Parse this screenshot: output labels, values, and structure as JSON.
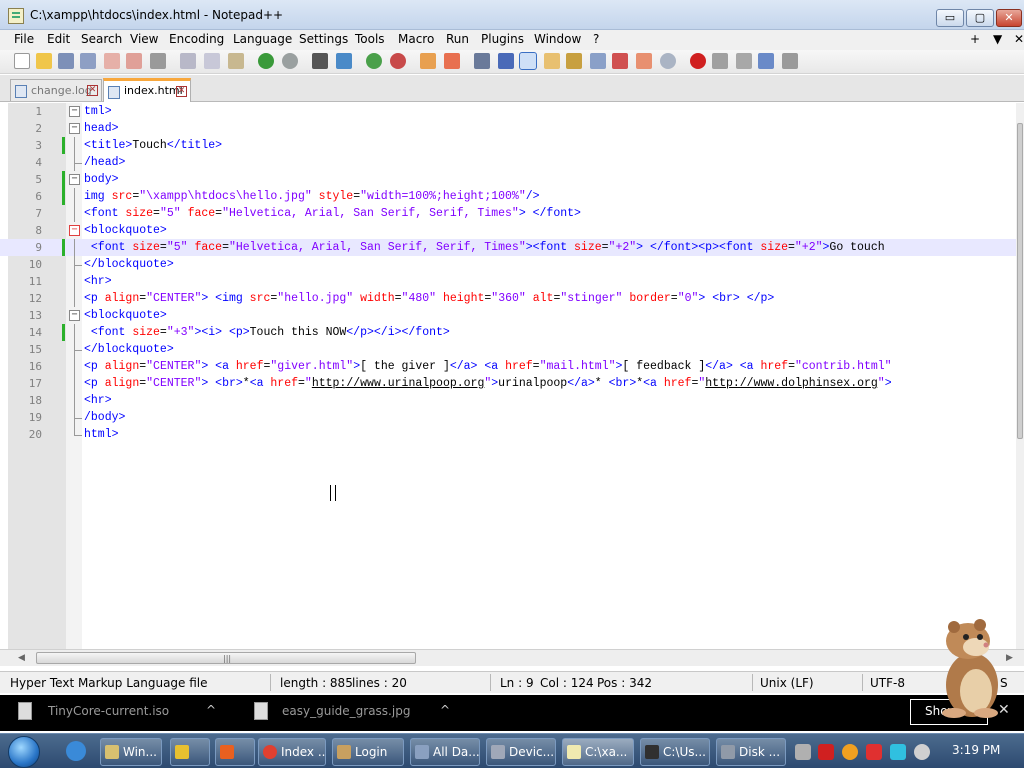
{
  "window": {
    "title": "C:\\xampp\\htdocs\\index.html - Notepad++",
    "min_glyph": "▭",
    "max_glyph": "▢",
    "close_glyph": "✕"
  },
  "menu": {
    "items": [
      "File",
      "Edit",
      "Search",
      "View",
      "Encoding",
      "Language",
      "Settings",
      "Tools",
      "Macro",
      "Run",
      "Plugins",
      "Window",
      "?"
    ],
    "right": [
      "+",
      "▼",
      "✕"
    ]
  },
  "tabs": [
    {
      "label": "change.log",
      "active": false
    },
    {
      "label": "index.html",
      "active": true
    }
  ],
  "editor": {
    "current_line": 9,
    "lines": [
      {
        "n": "1",
        "seg": [
          [
            "t",
            "tml>"
          ]
        ]
      },
      {
        "n": "2",
        "seg": [
          [
            "t",
            "head>"
          ]
        ]
      },
      {
        "n": "3",
        "seg": [
          [
            "t",
            "<title>"
          ],
          [
            "x",
            "Touch"
          ],
          [
            "t",
            "</title>"
          ]
        ]
      },
      {
        "n": "4",
        "seg": [
          [
            "t",
            "/head>"
          ]
        ]
      },
      {
        "n": "5",
        "seg": [
          [
            "t",
            "body>"
          ]
        ]
      },
      {
        "n": "6",
        "seg": [
          [
            "t",
            "img "
          ],
          [
            "a",
            "src"
          ],
          [
            "x",
            "="
          ],
          [
            "v",
            "\"\\xampp\\htdocs\\hello.jpg\""
          ],
          [
            "x",
            " "
          ],
          [
            "a",
            "style"
          ],
          [
            "x",
            "="
          ],
          [
            "v",
            "\"width=100%;height;100%\""
          ],
          [
            "t",
            "/>"
          ]
        ]
      },
      {
        "n": "7",
        "seg": [
          [
            "t",
            "<font "
          ],
          [
            "a",
            "size"
          ],
          [
            "x",
            "="
          ],
          [
            "v",
            "\"5\""
          ],
          [
            "x",
            " "
          ],
          [
            "a",
            "face"
          ],
          [
            "x",
            "="
          ],
          [
            "v",
            "\"Helvetica, Arial, San Serif, Serif, Times\""
          ],
          [
            "t",
            "> </font>"
          ]
        ]
      },
      {
        "n": "8",
        "seg": [
          [
            "t",
            "<blockquote>"
          ]
        ]
      },
      {
        "n": "9",
        "seg": [
          [
            "t",
            " <font "
          ],
          [
            "a",
            "size"
          ],
          [
            "x",
            "="
          ],
          [
            "v",
            "\"5\""
          ],
          [
            "x",
            " "
          ],
          [
            "a",
            "face"
          ],
          [
            "x",
            "="
          ],
          [
            "v",
            "\"Helvetica, Arial, San Serif, Serif, Times\""
          ],
          [
            "t",
            "><font "
          ],
          [
            "a",
            "size"
          ],
          [
            "x",
            "="
          ],
          [
            "v",
            "\"+2\""
          ],
          [
            "t",
            "> </font><p><font "
          ],
          [
            "a",
            "size"
          ],
          [
            "x",
            "="
          ],
          [
            "v",
            "\"+2\""
          ],
          [
            "t",
            ">"
          ],
          [
            "x",
            "Go touch"
          ]
        ]
      },
      {
        "n": "10",
        "seg": [
          [
            "t",
            "</blockquote>"
          ]
        ]
      },
      {
        "n": "11",
        "seg": [
          [
            "t",
            "<hr>"
          ]
        ]
      },
      {
        "n": "12",
        "seg": [
          [
            "t",
            "<p "
          ],
          [
            "a",
            "align"
          ],
          [
            "x",
            "="
          ],
          [
            "v",
            "\"CENTER\""
          ],
          [
            "t",
            "> <img "
          ],
          [
            "a",
            "src"
          ],
          [
            "x",
            "="
          ],
          [
            "v",
            "\"hello.jpg\""
          ],
          [
            "x",
            " "
          ],
          [
            "a",
            "width"
          ],
          [
            "x",
            "="
          ],
          [
            "v",
            "\"480\""
          ],
          [
            "x",
            " "
          ],
          [
            "a",
            "height"
          ],
          [
            "x",
            "="
          ],
          [
            "v",
            "\"360\""
          ],
          [
            "x",
            " "
          ],
          [
            "a",
            "alt"
          ],
          [
            "x",
            "="
          ],
          [
            "v",
            "\"stinger\""
          ],
          [
            "x",
            " "
          ],
          [
            "a",
            "border"
          ],
          [
            "x",
            "="
          ],
          [
            "v",
            "\"0\""
          ],
          [
            "t",
            "> <br> </p>"
          ]
        ]
      },
      {
        "n": "13",
        "seg": [
          [
            "t",
            "<blockquote>"
          ]
        ]
      },
      {
        "n": "14",
        "seg": [
          [
            "t",
            " <font "
          ],
          [
            "a",
            "size"
          ],
          [
            "x",
            "="
          ],
          [
            "v",
            "\"+3\""
          ],
          [
            "t",
            "><i> <p>"
          ],
          [
            "x",
            "Touch this NOW"
          ],
          [
            "t",
            "</p></i></font>"
          ]
        ]
      },
      {
        "n": "15",
        "seg": [
          [
            "t",
            "</blockquote>"
          ]
        ]
      },
      {
        "n": "16",
        "seg": [
          [
            "t",
            "<p "
          ],
          [
            "a",
            "align"
          ],
          [
            "x",
            "="
          ],
          [
            "v",
            "\"CENTER\""
          ],
          [
            "t",
            "> <a "
          ],
          [
            "a",
            "href"
          ],
          [
            "x",
            "="
          ],
          [
            "v",
            "\"giver.html\""
          ],
          [
            "t",
            ">"
          ],
          [
            "x",
            "[ the giver ]"
          ],
          [
            "t",
            "</a> <a "
          ],
          [
            "a",
            "href"
          ],
          [
            "x",
            "="
          ],
          [
            "v",
            "\"mail.html\""
          ],
          [
            "t",
            ">"
          ],
          [
            "x",
            "[ feedback ]"
          ],
          [
            "t",
            "</a> <a "
          ],
          [
            "a",
            "href"
          ],
          [
            "x",
            "="
          ],
          [
            "v",
            "\"contrib.html\""
          ]
        ]
      },
      {
        "n": "17",
        "seg": [
          [
            "t",
            "<p "
          ],
          [
            "a",
            "align"
          ],
          [
            "x",
            "="
          ],
          [
            "v",
            "\"CENTER\""
          ],
          [
            "t",
            "> <br>"
          ],
          [
            "x",
            "*"
          ],
          [
            "t",
            "<a "
          ],
          [
            "a",
            "href"
          ],
          [
            "x",
            "="
          ],
          [
            "v",
            "\""
          ],
          [
            "u",
            "http://www.urinalpoop.org"
          ],
          [
            "v",
            "\""
          ],
          [
            "t",
            ">"
          ],
          [
            "x",
            "urinalpoop"
          ],
          [
            "t",
            "</a>"
          ],
          [
            "x",
            "* "
          ],
          [
            "t",
            "<br>"
          ],
          [
            "x",
            "*"
          ],
          [
            "t",
            "<a "
          ],
          [
            "a",
            "href"
          ],
          [
            "x",
            "="
          ],
          [
            "v",
            "\""
          ],
          [
            "u",
            "http://www.dolphinsex.org"
          ],
          [
            "v",
            "\""
          ],
          [
            "t",
            ">"
          ]
        ]
      },
      {
        "n": "18",
        "seg": [
          [
            "t",
            "<hr>"
          ]
        ]
      },
      {
        "n": "19",
        "seg": [
          [
            "t",
            "/body>"
          ]
        ]
      },
      {
        "n": "20",
        "seg": [
          [
            "t",
            "html>"
          ]
        ]
      }
    ]
  },
  "status": {
    "filetype": "Hyper Text Markup Language file",
    "length": "length : 885",
    "lines": "lines : 20",
    "ln": "Ln : 9",
    "col": "Col : 124",
    "pos": "Pos : 342",
    "eol": "Unix (LF)",
    "encoding": "UTF-8",
    "mode": "S"
  },
  "downloads": {
    "items": [
      "TinyCore-current.iso",
      "easy_guide_grass.jpg"
    ],
    "show_all": "Show",
    "chevron": "^"
  },
  "taskbar": {
    "tasks": [
      "Win...",
      "",
      "",
      "Index ...",
      "Login",
      "All Da...",
      "Devic...",
      "C:\\xa...",
      "C:\\Us...",
      "Disk ..."
    ],
    "clock": "3:19 PM"
  },
  "colors": {
    "tag": "#0000ff",
    "attr": "#ff0000",
    "value": "#8000ff",
    "current_line": "#e8e8ff",
    "change_marker": "#2bb02b",
    "tab_accent": "#f8a73c"
  }
}
